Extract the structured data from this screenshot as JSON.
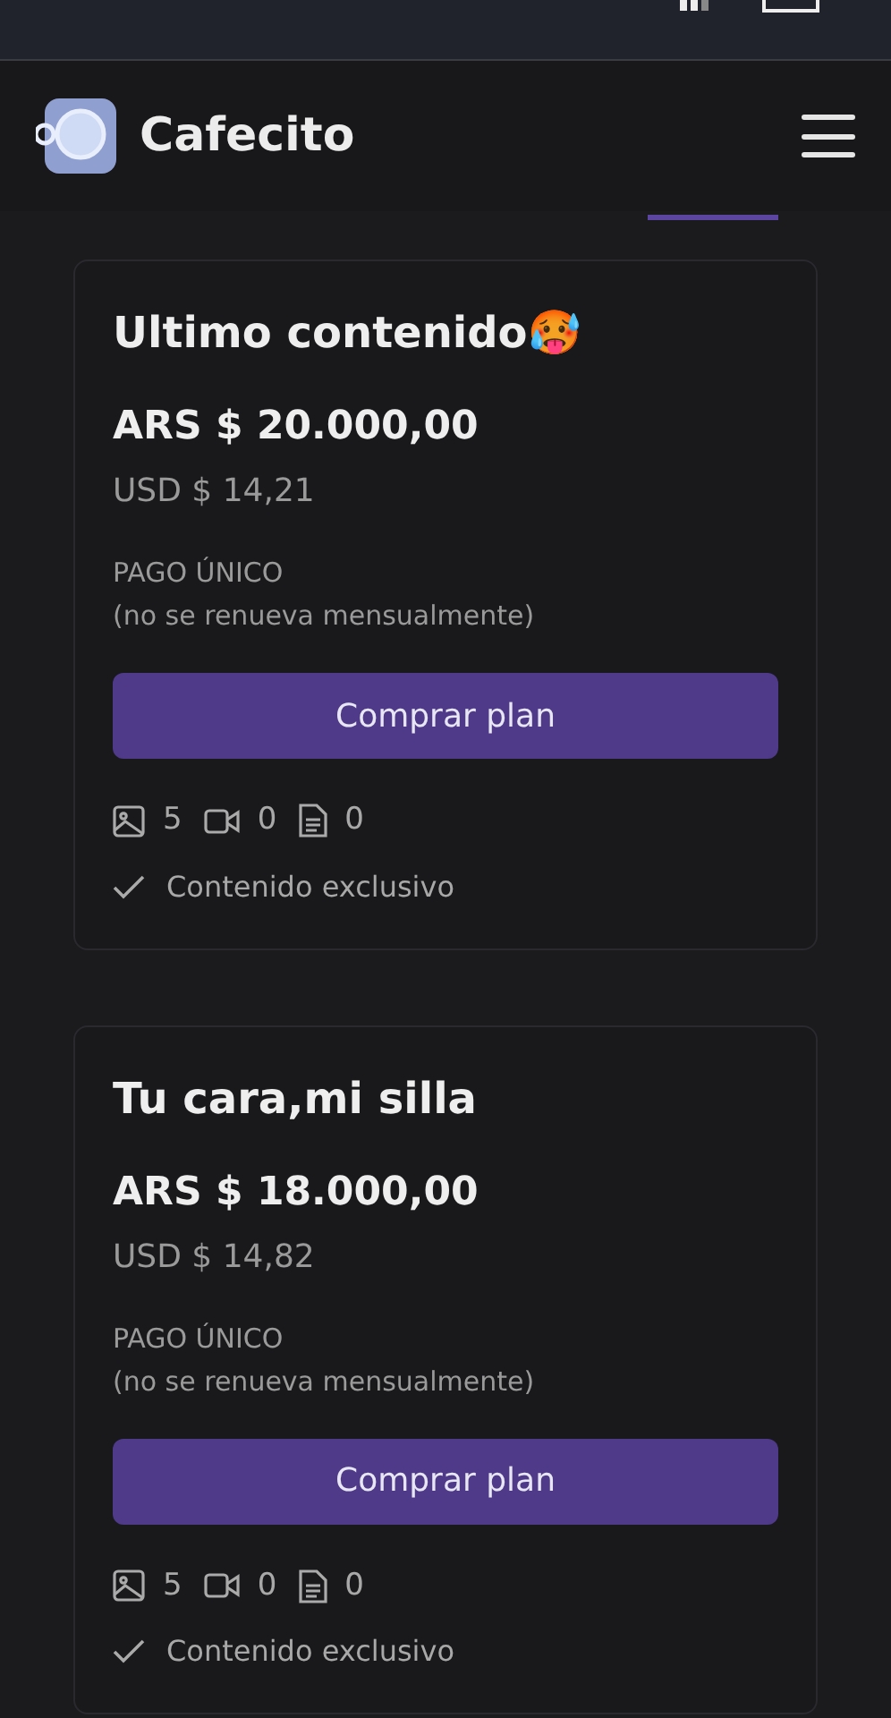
{
  "header": {
    "brand": "Cafecito"
  },
  "plans": [
    {
      "title": "Ultimo contenido🥵",
      "price": "ARS $ 20.000,00",
      "usd": "USD $ 14,21",
      "payment": "PAGO ÚNICO",
      "renewal": "(no se renueva mensualmente)",
      "button": "Comprar plan",
      "counts": [
        {
          "kind": "image",
          "value": "5"
        },
        {
          "kind": "video",
          "value": "0"
        },
        {
          "kind": "document",
          "value": "0"
        }
      ],
      "features": [
        "Contenido exclusivo"
      ]
    },
    {
      "title": "Tu cara,mi silla",
      "price": "ARS $ 18.000,00",
      "usd": "USD $ 14,82",
      "payment": "PAGO ÚNICO",
      "renewal": "(no se renueva mensualmente)",
      "button": "Comprar plan",
      "counts": [
        {
          "kind": "image",
          "value": "5"
        },
        {
          "kind": "video",
          "value": "0"
        },
        {
          "kind": "document",
          "value": "0"
        }
      ],
      "features": [
        "Contenido exclusivo"
      ]
    }
  ]
}
